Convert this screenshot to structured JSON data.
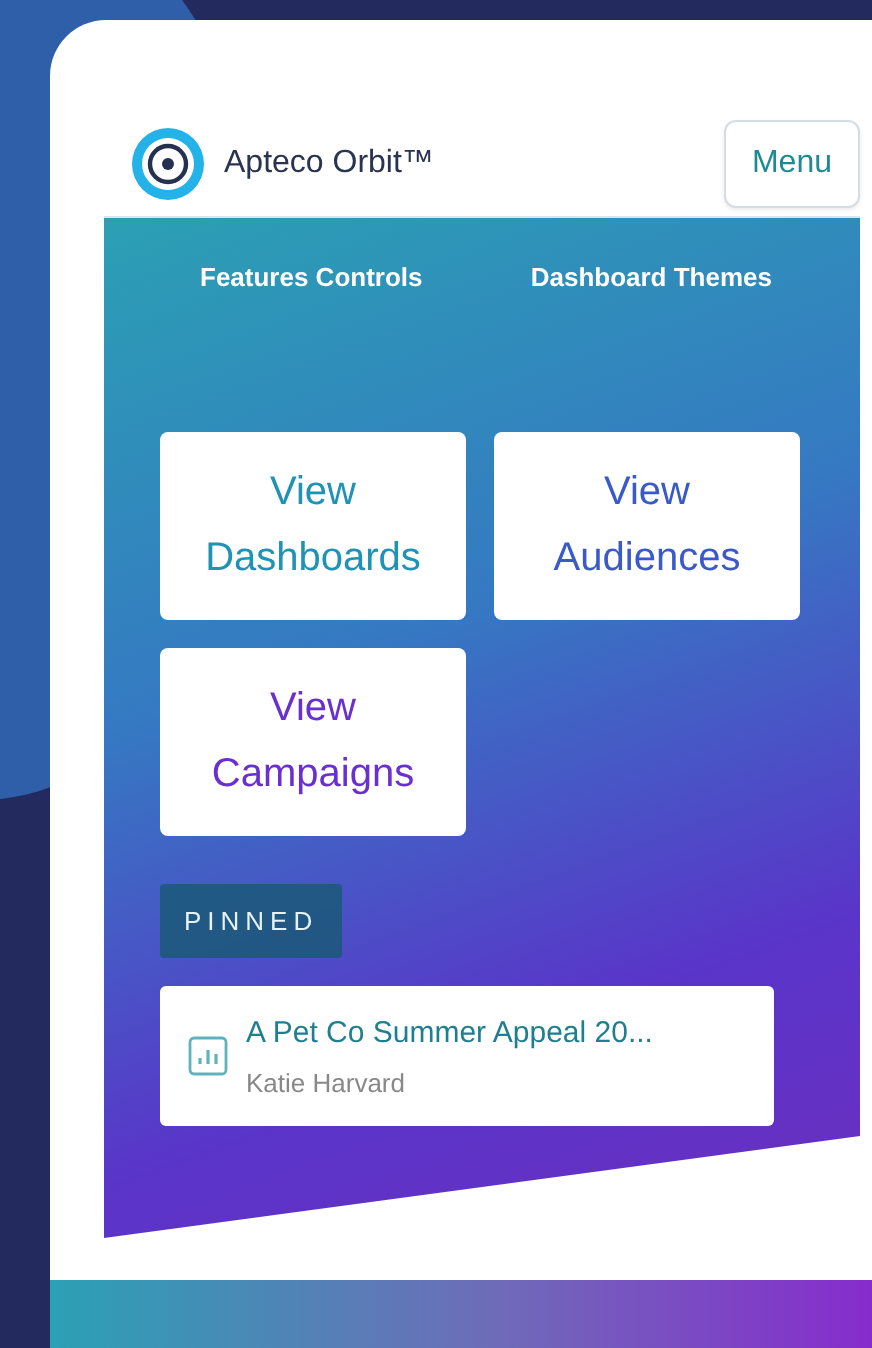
{
  "header": {
    "brand": "Apteco Orbit™",
    "menu_button": "Menu"
  },
  "nav_links": [
    "Features Controls",
    "Dashboard Themes"
  ],
  "tiles": [
    {
      "line1": "View",
      "line2": "Dashboards"
    },
    {
      "line1": "View",
      "line2": "Audiences"
    },
    {
      "line1": "View",
      "line2": "Campaigns"
    }
  ],
  "pinned": {
    "label": "PINNED",
    "items": [
      {
        "title": "A Pet Co Summer Appeal 20...",
        "owner": "Katie Harvard"
      }
    ]
  }
}
